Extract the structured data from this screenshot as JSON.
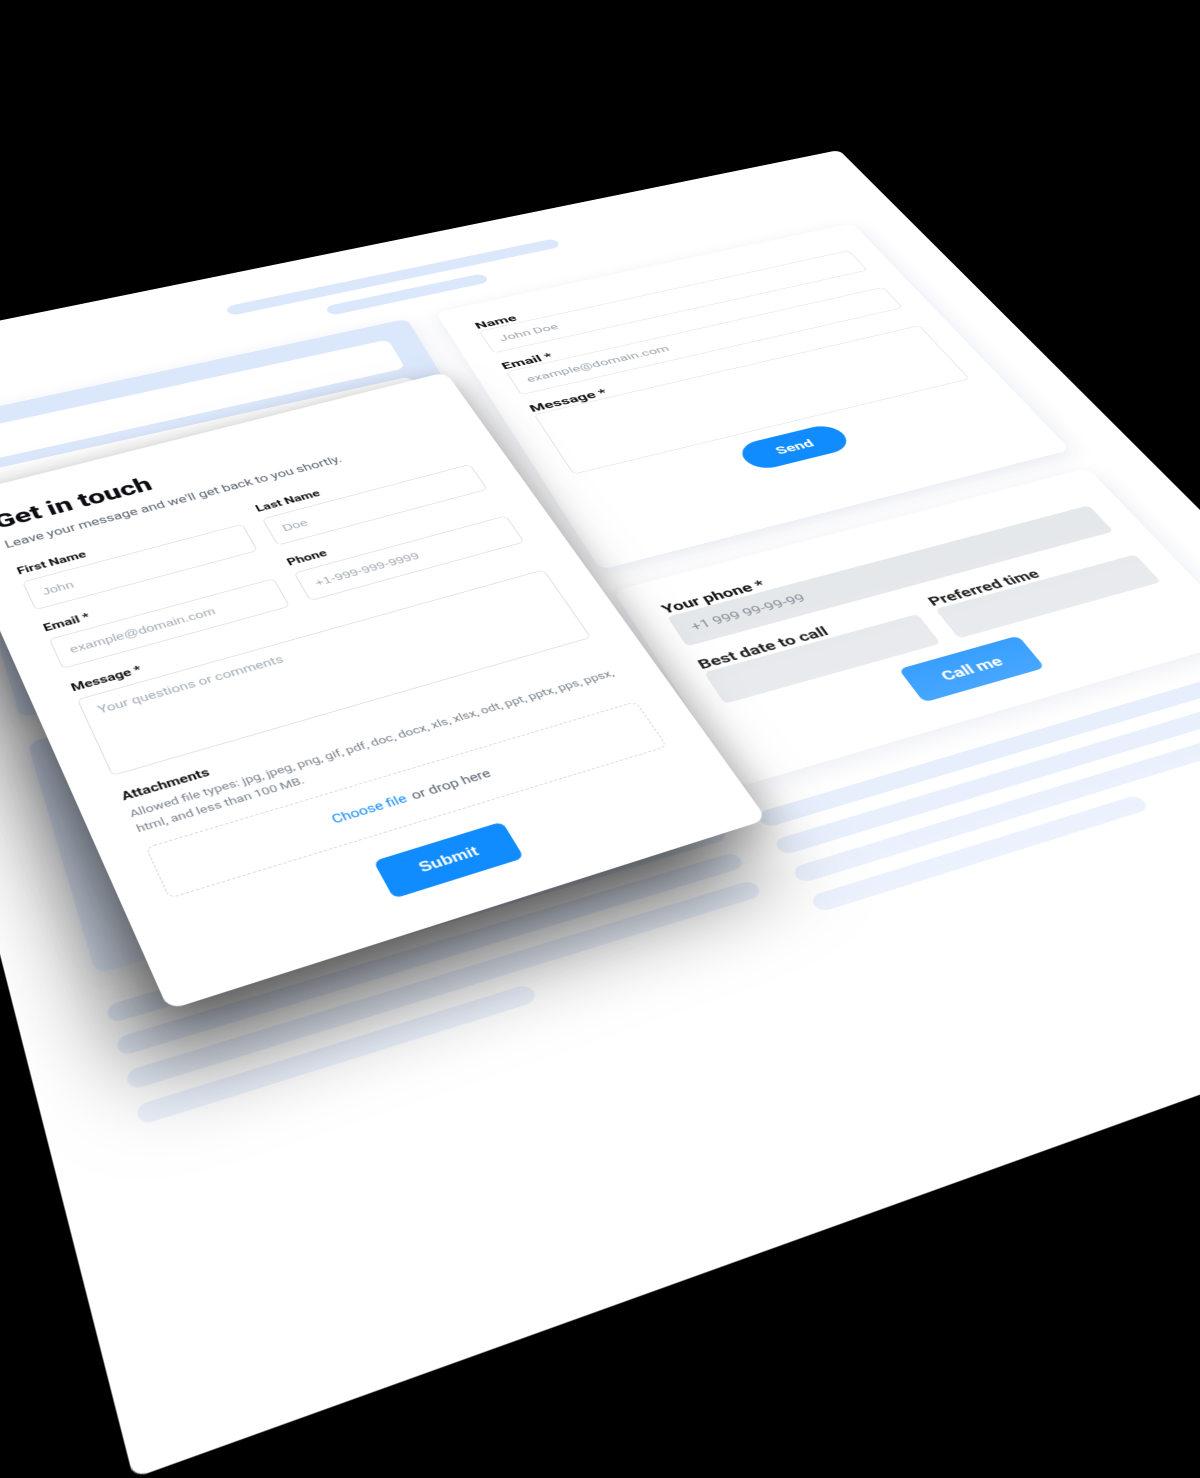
{
  "colors": {
    "accent": "#108cff",
    "placeholder_bg": "#dbe7fb"
  },
  "contact_form": {
    "title": "Get in touch",
    "subtitle": "Leave your message and we'll get back to you shortly.",
    "first_name": {
      "label": "First Name",
      "placeholder": "John"
    },
    "last_name": {
      "label": "Last Name",
      "placeholder": "Doe"
    },
    "email": {
      "label": "Email *",
      "placeholder": "example@domain.com"
    },
    "phone": {
      "label": "Phone",
      "placeholder": "+1-999-999-9999"
    },
    "message": {
      "label": "Message *",
      "placeholder": "Your questions or comments"
    },
    "attachments": {
      "label": "Attachments",
      "hint": "Allowed file types: jpg, jpeg, png, gif, pdf, doc, docx, xls, xlsx, odt, ppt, pptx, pps, ppsx, html, and less than 100 MB.",
      "choose": "Choose file",
      "drop": " or drop here"
    },
    "submit": "Submit"
  },
  "simple_form": {
    "name": {
      "label": "Name",
      "placeholder": "John Doe"
    },
    "email": {
      "label": "Email *",
      "placeholder": "example@domain.com"
    },
    "message": {
      "label": "Message *"
    },
    "submit": "Send"
  },
  "callback_form": {
    "phone": {
      "label": "Your phone *",
      "placeholder": "+1 999 99-99-99"
    },
    "date": {
      "label": "Best date to call"
    },
    "time": {
      "label": "Preferred time"
    },
    "submit": "Call me"
  }
}
